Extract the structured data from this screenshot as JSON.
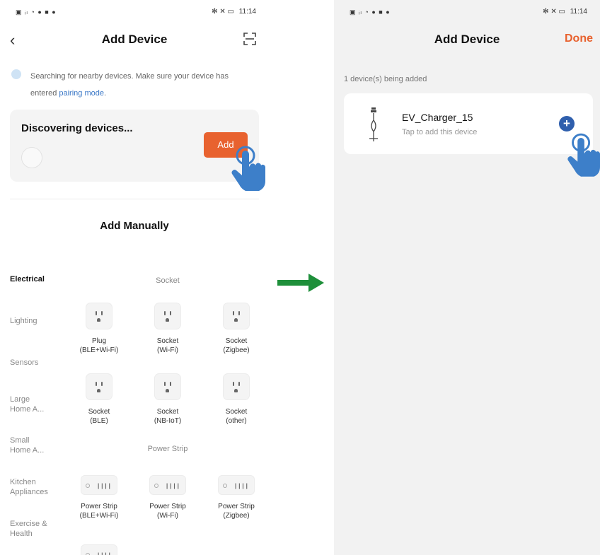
{
  "left": {
    "status": {
      "icons": "▣ ᵢₗ ◔ ● ■ ●",
      "right_icons": "✻ ✕ ▭",
      "time": "11:14"
    },
    "header": {
      "title": "Add Device",
      "back_icon": "chevron-left-icon",
      "scan_icon": "scan-icon"
    },
    "tip": {
      "line1": "Searching for nearby devices. Make sure your device has",
      "line2_prefix": "entered ",
      "line2_link": "pairing mode",
      "line2_suffix": "."
    },
    "discovering": {
      "title": "Discovering devices...",
      "add_label": "Add"
    },
    "manual": {
      "title": "Add Manually"
    },
    "categories": [
      "Electrical",
      "Lighting",
      "Sensors",
      "Large\nHome A...",
      "Small\nHome A...",
      "Kitchen\nAppliances",
      "Exercise &\nHealth"
    ],
    "sections": {
      "socket": "Socket",
      "power_strip": "Power Strip"
    },
    "sockets": [
      {
        "label": "Plug\n(BLE+Wi-Fi)"
      },
      {
        "label": "Socket\n(Wi-Fi)"
      },
      {
        "label": "Socket\n(Zigbee)"
      },
      {
        "label": "Socket\n(BLE)"
      },
      {
        "label": "Socket\n(NB-IoT)"
      },
      {
        "label": "Socket\n(other)"
      }
    ],
    "strips": [
      {
        "label": "Power Strip\n(BLE+Wi-Fi)"
      },
      {
        "label": "Power Strip\n(Wi-Fi)"
      },
      {
        "label": "Power Strip\n(Zigbee)"
      }
    ]
  },
  "right": {
    "status": {
      "icons": "▣ ᵢₗ ◔ ● ■ ●",
      "right_icons": "✻ ✕ ▭",
      "time": "11:14"
    },
    "header": {
      "title": "Add Device",
      "done_label": "Done"
    },
    "count_text": "1 device(s) being added",
    "device": {
      "name": "EV_Charger_15",
      "subtitle": "Tap to add this device",
      "add_icon": "plus-circle-icon"
    }
  },
  "colors": {
    "accent": "#e8622f",
    "blue": "#2f5fad",
    "arrow": "#1e8f3a",
    "hand": "#3d7fc9"
  }
}
